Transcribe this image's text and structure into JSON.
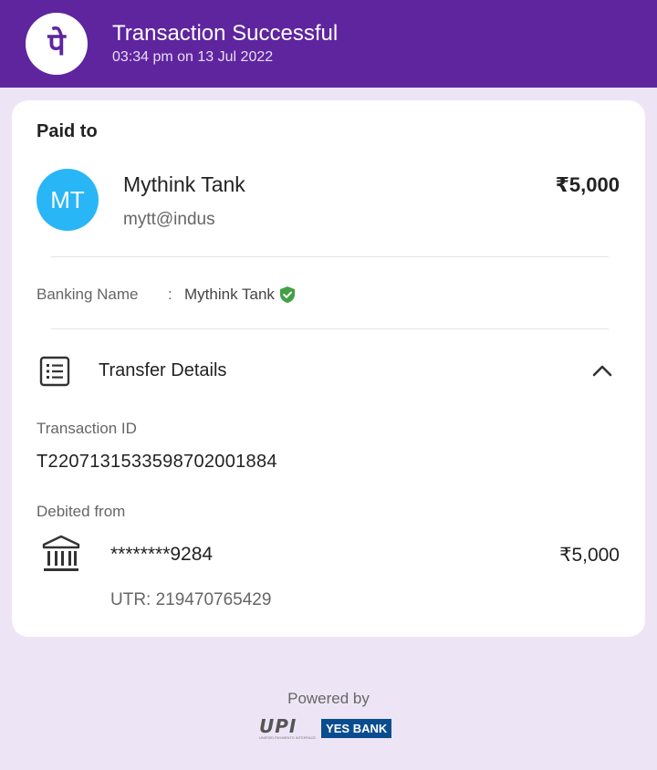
{
  "header": {
    "title": "Transaction Successful",
    "datetime": "03:34 pm on 13 Jul 2022",
    "logo_glyph": "पे",
    "color": "#5f259f"
  },
  "paid_to": {
    "section_label": "Paid to",
    "avatar_initials": "MT",
    "avatar_color": "#29b6f6",
    "name": "Mythink Tank",
    "upi_id": "mytt@indus",
    "amount": "₹5,000"
  },
  "banking": {
    "label": "Banking Name",
    "separator": ":",
    "value": "Mythink Tank",
    "verified_icon": "verified-shield-icon"
  },
  "transfer": {
    "title": "Transfer Details",
    "icon": "receipt-list-icon",
    "toggle_icon": "chevron-up-icon",
    "transaction_id_label": "Transaction ID",
    "transaction_id": "T2207131533598702001884",
    "debited_from_label": "Debited from",
    "account_masked": "********9284",
    "debit_amount": "₹5,000",
    "utr": "UTR: 219470765429",
    "bank_icon": "bank-building-icon"
  },
  "footer": {
    "powered_by": "Powered by",
    "upi_logo": "UPI",
    "upi_sub": "UNIFIED PAYMENTS INTERFACE",
    "bank_logo": "YES BANK"
  }
}
